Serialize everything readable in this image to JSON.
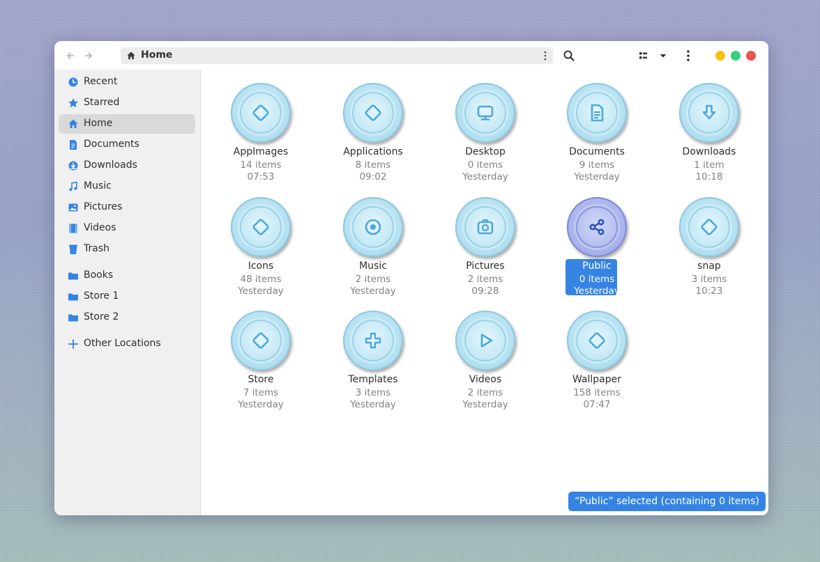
{
  "headerbar": {
    "back_icon": "arrow-left-icon",
    "forward_icon": "arrow-right-icon",
    "path_label": "Home",
    "search_icon": "search-icon",
    "view_icon": "view-list-icon",
    "view_menu_icon": "chevron-down-icon",
    "menu_icon": "kebab-menu-icon",
    "window_controls": [
      {
        "name": "minimize-button",
        "color": "#f5c211"
      },
      {
        "name": "maximize-button",
        "color": "#33d17a"
      },
      {
        "name": "close-button",
        "color": "#e9544f"
      }
    ]
  },
  "sidebar": {
    "items": [
      {
        "label": "Recent",
        "icon": "clock-icon"
      },
      {
        "label": "Starred",
        "icon": "star-icon"
      },
      {
        "label": "Home",
        "icon": "home-icon",
        "active": true
      },
      {
        "label": "Documents",
        "icon": "document-icon"
      },
      {
        "label": "Downloads",
        "icon": "download-icon"
      },
      {
        "label": "Music",
        "icon": "music-note-icon"
      },
      {
        "label": "Pictures",
        "icon": "image-icon"
      },
      {
        "label": "Videos",
        "icon": "film-icon"
      },
      {
        "label": "Trash",
        "icon": "trash-icon"
      }
    ],
    "bookmarks": [
      {
        "label": "Books",
        "icon": "folder-icon"
      },
      {
        "label": "Store 1",
        "icon": "folder-icon"
      },
      {
        "label": "Store 2",
        "icon": "folder-icon"
      }
    ],
    "other": {
      "label": "Other Locations",
      "icon": "plus-icon"
    }
  },
  "files": [
    {
      "name": "AppImages",
      "count": "14 items",
      "time": "07:53",
      "icon": "diamond-icon"
    },
    {
      "name": "Applications",
      "count": "8 items",
      "time": "09:02",
      "icon": "diamond-icon"
    },
    {
      "name": "Desktop",
      "count": "0 items",
      "time": "Yesterday",
      "icon": "monitor-icon"
    },
    {
      "name": "Documents",
      "count": "9 items",
      "time": "Yesterday",
      "icon": "document-icon"
    },
    {
      "name": "Downloads",
      "count": "1 item",
      "time": "10:18",
      "icon": "download-arrow-icon"
    },
    {
      "name": "Icons",
      "count": "48 items",
      "time": "Yesterday",
      "icon": "diamond-icon"
    },
    {
      "name": "Music",
      "count": "2 items",
      "time": "Yesterday",
      "icon": "record-icon"
    },
    {
      "name": "Pictures",
      "count": "2 items",
      "time": "09:28",
      "icon": "camera-icon"
    },
    {
      "name": "Public",
      "count": "0 items",
      "time": "Yesterday",
      "icon": "share-icon",
      "selected": true
    },
    {
      "name": "snap",
      "count": "3 items",
      "time": "10:23",
      "icon": "diamond-icon"
    },
    {
      "name": "Store",
      "count": "7 items",
      "time": "Yesterday",
      "icon": "diamond-icon"
    },
    {
      "name": "Templates",
      "count": "3 items",
      "time": "Yesterday",
      "icon": "plus-icon"
    },
    {
      "name": "Videos",
      "count": "2 items",
      "time": "Yesterday",
      "icon": "play-icon"
    },
    {
      "name": "Wallpaper",
      "count": "158 items",
      "time": "07:47",
      "icon": "diamond-icon"
    }
  ],
  "status": {
    "text": "“Public” selected  (containing 0 items)"
  },
  "colors": {
    "accent": "#3584e4",
    "icon_blue": "#4aa8e0",
    "selected_icon": "#3355cc"
  }
}
